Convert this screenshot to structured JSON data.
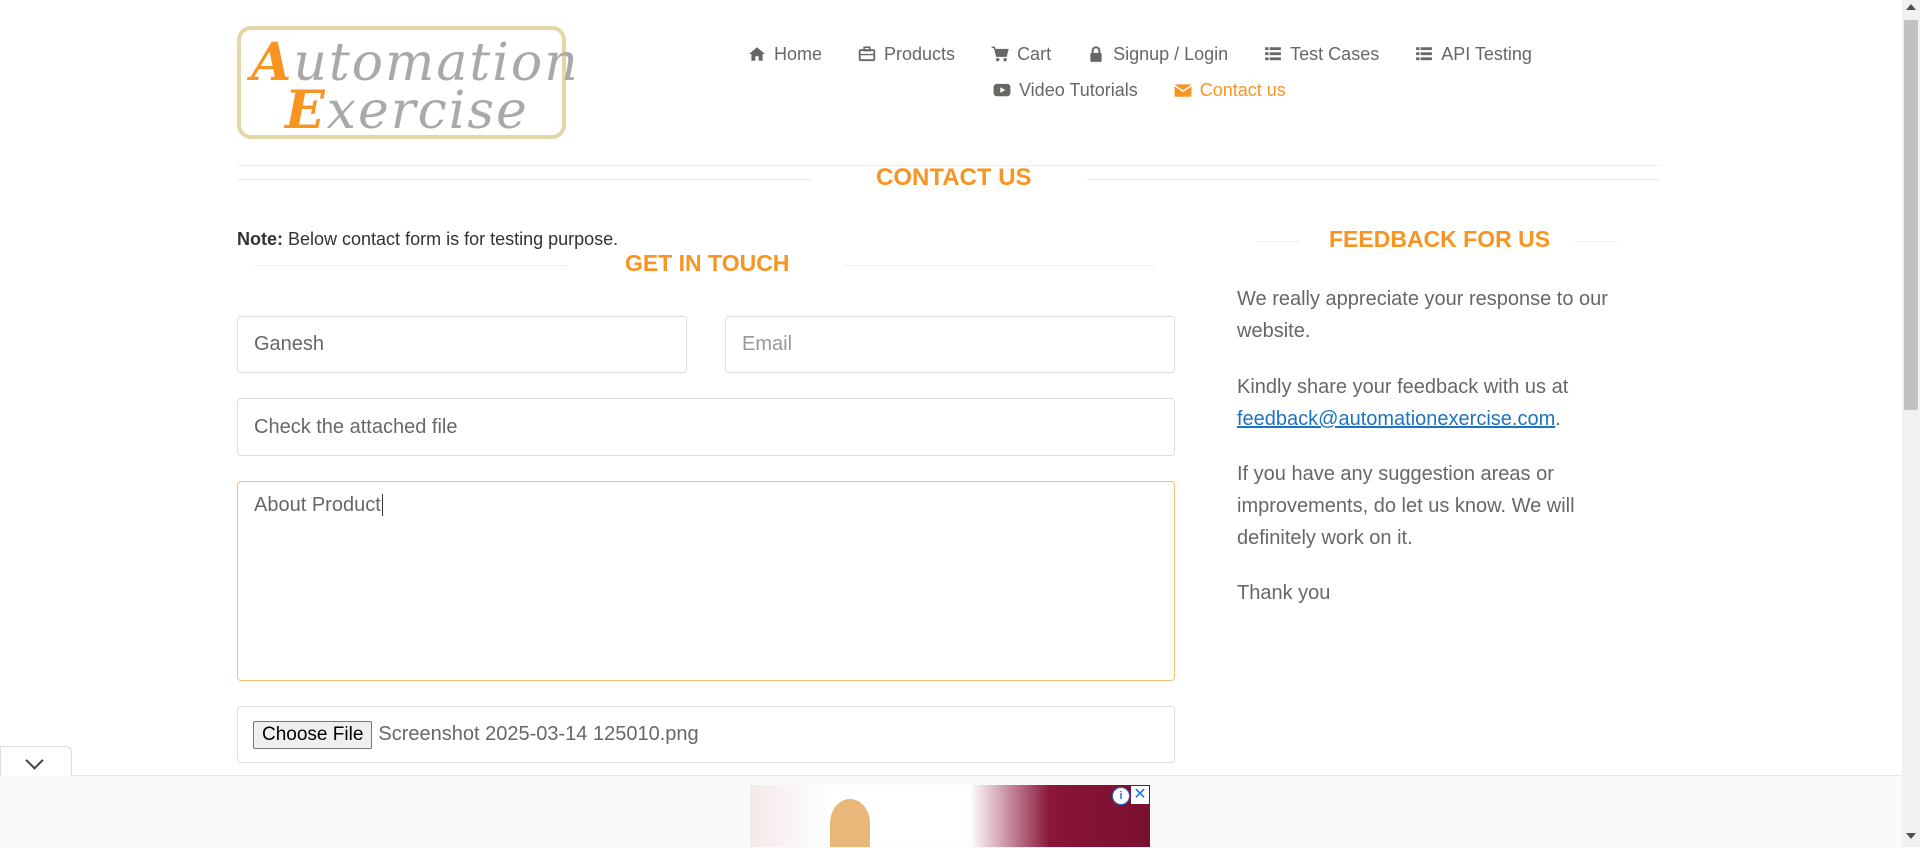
{
  "logo": {
    "line1_cap": "A",
    "line1_rest": "utomation",
    "line2_cap": "E",
    "line2_rest": "xercise"
  },
  "nav": {
    "items_row1": [
      {
        "label": "Home",
        "icon": "home-icon"
      },
      {
        "label": "Products",
        "icon": "briefcase-icon"
      },
      {
        "label": "Cart",
        "icon": "cart-icon"
      },
      {
        "label": "Signup / Login",
        "icon": "lock-icon"
      },
      {
        "label": "Test Cases",
        "icon": "list-icon"
      },
      {
        "label": "API Testing",
        "icon": "list-icon"
      }
    ],
    "items_row2": [
      {
        "label": "Video Tutorials",
        "icon": "youtube-icon"
      },
      {
        "label": "Contact us",
        "icon": "envelope-icon",
        "active": true
      }
    ]
  },
  "page": {
    "contact_title": "CONTACT US",
    "note_bold": "Note:",
    "note_text": " Below contact form is for testing purpose.",
    "get_in_touch": "GET IN TOUCH",
    "feedback_title": "FEEDBACK FOR US"
  },
  "form": {
    "name_value": "Ganesh",
    "email_placeholder": "Email",
    "subject_value": "Check the attached file",
    "message_value": "About Product",
    "choose_file_label": "Choose File",
    "file_name": "Screenshot 2025-03-14 125010.png"
  },
  "feedback": {
    "p1": "We really appreciate your response to our website.",
    "p2_text": "Kindly share your feedback with us at ",
    "p2_link": "feedback@automationexercise.com",
    "p2_end": ".",
    "p3": "If you have any suggestion areas or improvements, do let us know. We will definitely work on it.",
    "p4": "Thank you"
  },
  "colors": {
    "accent": "#f79422",
    "text": "#696763",
    "link": "#1e73be"
  }
}
